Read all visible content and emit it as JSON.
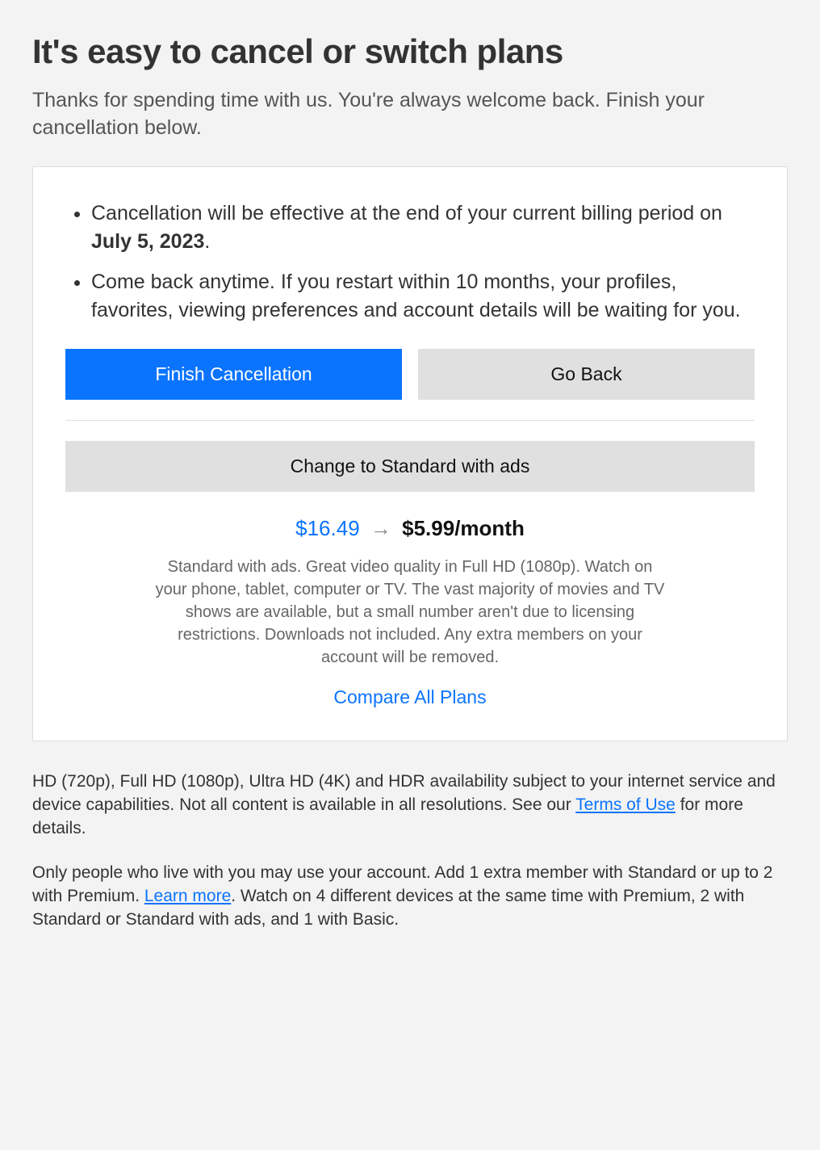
{
  "heading": "It's easy to cancel or switch plans",
  "subtitle": "Thanks for spending time with us. You're always welcome back. Finish your cancellation below.",
  "bullets": {
    "b1_prefix": "Cancellation will be effective at the end of your current billing period on ",
    "b1_date": "July 5, 2023",
    "b1_suffix": ".",
    "b2": "Come back anytime. If you restart within 10 months, your profiles, favorites, viewing preferences and account details will be waiting for you."
  },
  "buttons": {
    "finish": "Finish Cancellation",
    "go_back": "Go Back",
    "change_plan": "Change to Standard with ads"
  },
  "pricing": {
    "old": "$16.49",
    "arrow": "→",
    "new": "$5.99/month"
  },
  "plan_description": "Standard with ads. Great video quality in Full HD (1080p). Watch on your phone, tablet, computer or TV. The vast majority of movies and TV shows are available, but a small number aren't due to licensing restrictions. Downloads not included. Any extra members on your account will be removed.",
  "compare_link": "Compare All Plans",
  "foot1_a": "HD (720p), Full HD (1080p), Ultra HD (4K) and HDR availability subject to your internet service and device capabilities. Not all content is available in all resolutions. See our ",
  "foot1_link": "Terms of Use",
  "foot1_b": " for more details.",
  "foot2_a": "Only people who live with you may use your account. Add 1 extra member with Standard or up to 2 with Premium. ",
  "foot2_link": "Learn more",
  "foot2_b": ". Watch on 4 different devices at the same time with Premium, 2 with Standard or Standard with ads, and 1 with Basic."
}
